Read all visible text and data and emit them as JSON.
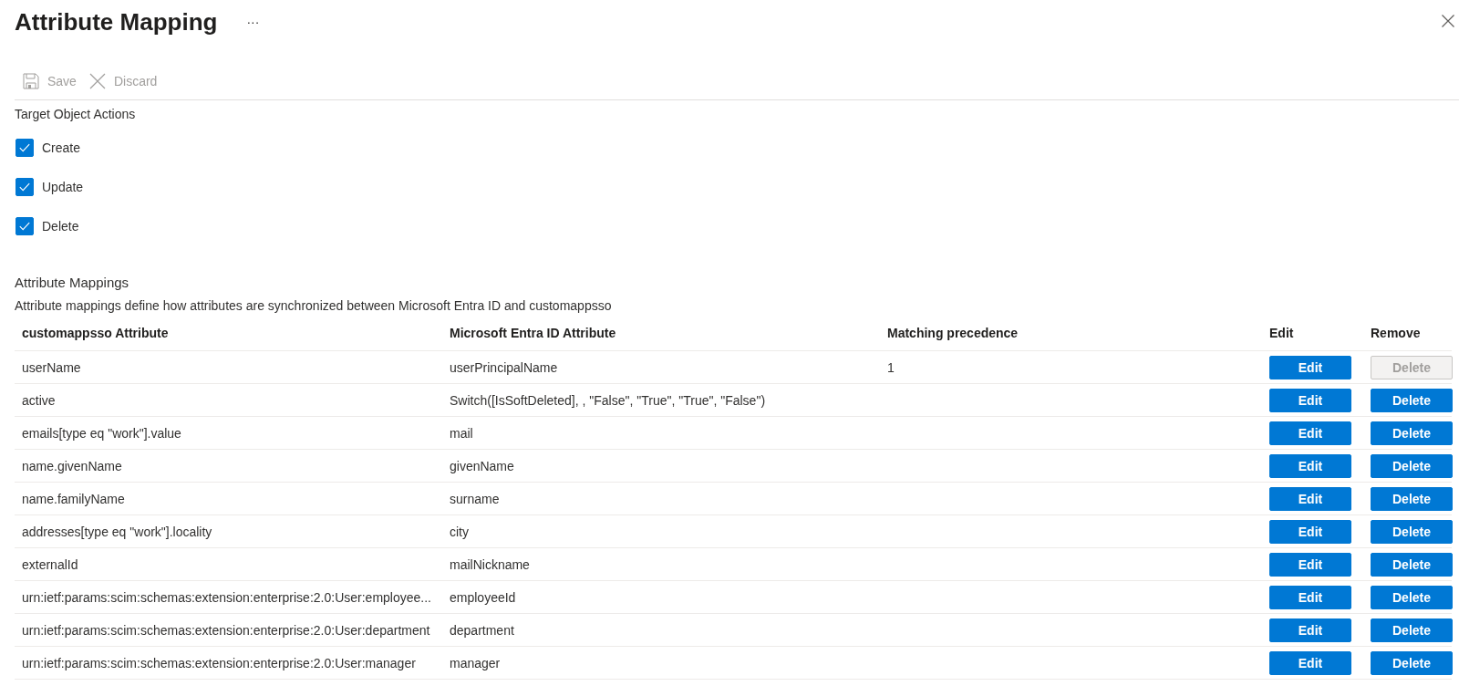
{
  "header": {
    "title": "Attribute Mapping",
    "more_label": "···"
  },
  "toolbar": [
    {
      "kind": "save",
      "label": "Save",
      "disabled": true
    },
    {
      "kind": "discard",
      "label": "Discard",
      "disabled": true
    }
  ],
  "target_object_actions": {
    "title": "Target Object Actions",
    "options": [
      {
        "label": "Create",
        "checked": true
      },
      {
        "label": "Update",
        "checked": true
      },
      {
        "label": "Delete",
        "checked": true
      }
    ]
  },
  "attribute_mappings": {
    "title": "Attribute Mappings",
    "description": "Attribute mappings define how attributes are synchronized between Microsoft Entra ID and customappsso",
    "columns": [
      "customappsso Attribute",
      "Microsoft Entra ID Attribute",
      "Matching precedence",
      "Edit",
      "Remove"
    ],
    "rows": [
      {
        "target": "userName",
        "source": "userPrincipalName",
        "precedence": "1",
        "edit_label": "Edit",
        "delete_label": "Delete",
        "delete_disabled": true
      },
      {
        "target": "active",
        "source": "Switch([IsSoftDeleted], , \"False\", \"True\", \"True\", \"False\")",
        "edit_label": "Edit",
        "delete_label": "Delete",
        "delete_disabled": false
      },
      {
        "target": "emails[type eq \"work\"].value",
        "source": "mail",
        "edit_label": "Edit",
        "delete_label": "Delete",
        "delete_disabled": false
      },
      {
        "target": "name.givenName",
        "source": "givenName",
        "edit_label": "Edit",
        "delete_label": "Delete",
        "delete_disabled": false
      },
      {
        "target": "name.familyName",
        "source": "surname",
        "edit_label": "Edit",
        "delete_label": "Delete",
        "delete_disabled": false
      },
      {
        "target": "addresses[type eq \"work\"].locality",
        "source": "city",
        "edit_label": "Edit",
        "delete_label": "Delete",
        "delete_disabled": false
      },
      {
        "target": "externalId",
        "source": "mailNickname",
        "edit_label": "Edit",
        "delete_label": "Delete",
        "delete_disabled": false
      },
      {
        "target": "urn:ietf:params:scim:schemas:extension:enterprise:2.0:User:employee...",
        "source": "employeeId",
        "edit_label": "Edit",
        "delete_label": "Delete",
        "delete_disabled": false
      },
      {
        "target": "urn:ietf:params:scim:schemas:extension:enterprise:2.0:User:department",
        "source": "department",
        "edit_label": "Edit",
        "delete_label": "Delete",
        "delete_disabled": false
      },
      {
        "target": "urn:ietf:params:scim:schemas:extension:enterprise:2.0:User:manager",
        "source": "manager",
        "edit_label": "Edit",
        "delete_label": "Delete",
        "delete_disabled": false
      }
    ]
  }
}
